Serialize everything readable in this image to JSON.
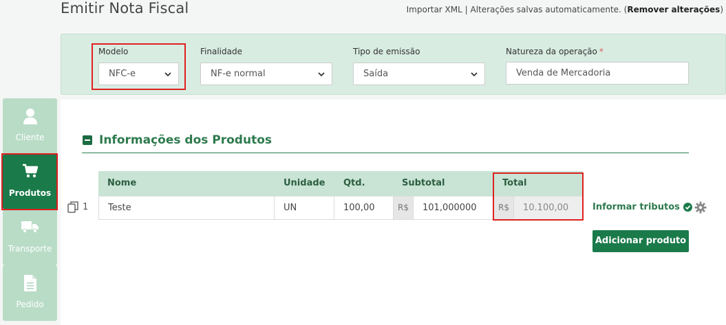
{
  "page": {
    "title": "Emitir Nota Fiscal"
  },
  "top_links": {
    "import": "Importar XML",
    "separator": " | ",
    "autosave": "Alterações salvas automaticamente. (",
    "remove": "Remover alterações",
    "close": ")"
  },
  "header": {
    "modelo": {
      "label": "Modelo",
      "value": "NFC-e"
    },
    "finalidade": {
      "label": "Finalidade",
      "value": "NF-e normal"
    },
    "tipo_emissao": {
      "label": "Tipo de emissão",
      "value": "Saída"
    },
    "natureza": {
      "label": "Natureza da operação",
      "required_mark": "*",
      "value": "Venda de Mercadoria"
    }
  },
  "sidebar": {
    "items": [
      {
        "label": "Cliente",
        "icon": "user-icon",
        "active": false
      },
      {
        "label": "Produtos",
        "icon": "cart-icon",
        "active": true
      },
      {
        "label": "Transporte",
        "icon": "truck-icon",
        "active": false
      },
      {
        "label": "Pedido",
        "icon": "document-icon",
        "active": false
      }
    ]
  },
  "products": {
    "section_title": "Informações dos Produtos",
    "columns": {
      "nome": "Nome",
      "unidade": "Unidade",
      "qtd": "Qtd.",
      "subtotal": "Subtotal",
      "total": "Total"
    },
    "rows": [
      {
        "index": "1",
        "nome": "Teste",
        "unidade": "UN",
        "qtd": "100,00",
        "currency": "R$",
        "subtotal": "101,000000",
        "total": "10.100,00"
      }
    ],
    "informar_label": "Informar tributos",
    "add_label": "Adicionar produto"
  },
  "colors": {
    "accent": "#1a7a4a",
    "panel": "#d8ece2",
    "highlight": "#e01f1f"
  }
}
